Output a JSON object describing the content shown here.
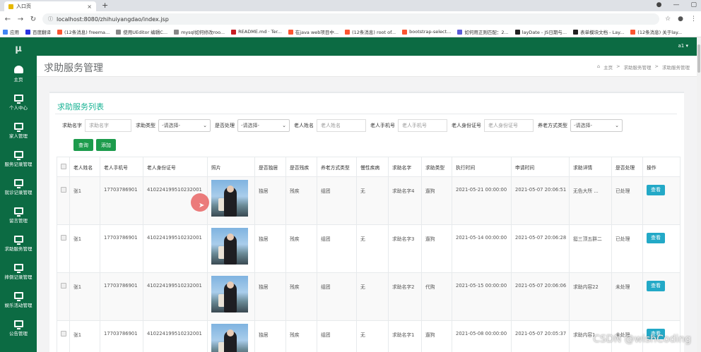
{
  "browser": {
    "tab_title": "入口页",
    "url": "localhost:8080/zhihuiyangdao/index.jsp",
    "bookmarks": [
      {
        "label": "应用",
        "color": "#4285f4"
      },
      {
        "label": "百度翻译",
        "color": "#2932e1"
      },
      {
        "label": "(12条消息) freema...",
        "color": "#fc5531"
      },
      {
        "label": "使用UEditor 编辑C...",
        "color": "#888888"
      },
      {
        "label": "mysql如何修改roo...",
        "color": "#888888"
      },
      {
        "label": "README.md · Ter...",
        "color": "#c71d23"
      },
      {
        "label": "在java web项目中...",
        "color": "#fc5531"
      },
      {
        "label": "(12条消息) root of...",
        "color": "#fc5531"
      },
      {
        "label": "bootstrap-select...",
        "color": "#fc5531"
      },
      {
        "label": "如何用正则匹配：2...",
        "color": "#5b5bd6"
      },
      {
        "label": "layDate - JS日期与...",
        "color": "#222222"
      },
      {
        "label": "表单模块文档 - Lay...",
        "color": "#222222"
      },
      {
        "label": "(12条消息) 关于lay...",
        "color": "#fc5531"
      }
    ]
  },
  "sidebar": {
    "logo": "μ",
    "items": [
      {
        "label": "主页",
        "icon": "dashboard-icon"
      },
      {
        "label": "个人中心",
        "icon": "monitor-icon"
      },
      {
        "label": "家人管理",
        "icon": "monitor-icon"
      },
      {
        "label": "服务记录管理",
        "icon": "monitor-icon"
      },
      {
        "label": "就诊记录管理",
        "icon": "monitor-icon"
      },
      {
        "label": "留言管理",
        "icon": "monitor-icon"
      },
      {
        "label": "求助服务管理",
        "icon": "monitor-icon"
      },
      {
        "label": "摔倒记录管理",
        "icon": "monitor-icon"
      },
      {
        "label": "娱乐活动管理",
        "icon": "monitor-icon"
      },
      {
        "label": "公告管理",
        "icon": "monitor-icon"
      }
    ]
  },
  "header": {
    "user": "a1 ▾",
    "page_title": "求助服务管理",
    "breadcrumb": [
      "主页",
      ">",
      "求助服务管理",
      ">",
      "求助服务管理"
    ]
  },
  "card": {
    "title": "求助服务列表",
    "filters": {
      "name_label": "求助名字",
      "name_placeholder": "求助名字",
      "type_label": "求助类型",
      "type_value": "-请选择-",
      "processed_label": "是否处理",
      "processed_value": "-请选择-",
      "elder_name_label": "老人姓名",
      "elder_name_placeholder": "老人姓名",
      "elder_phone_label": "老人手机号",
      "elder_phone_placeholder": "老人手机号",
      "elder_id_label": "老人身份证号",
      "elder_id_placeholder": "老人身份证号",
      "care_label": "养老方式类型",
      "care_value": "-请选择-"
    },
    "query_button": "查询",
    "add_button": "添加",
    "columns": [
      "老人姓名",
      "老人手机号",
      "老人身份证号",
      "照片",
      "是否独居",
      "是否残疾",
      "养老方式类型",
      "慢性疾病",
      "求助名字",
      "求助类型",
      "执行时间",
      "申请时间",
      "求助详情",
      "是否处理",
      "操作"
    ],
    "rows": [
      {
        "name": "张1",
        "phone": "17703786901",
        "id_no": "410224199510232001",
        "alone": "独居",
        "disabled": "残疾",
        "care": "组团",
        "disease": "无",
        "help_name": "求助名字4",
        "help_type": "遛狗",
        "exec_time": "2021-05-21 00:00:00",
        "apply_time": "2021-05-07 20:06:51",
        "detail": "无色大所 ...",
        "processed": "已处理",
        "action": "查看"
      },
      {
        "name": "张1",
        "phone": "17703786901",
        "id_no": "410224199510232001",
        "alone": "独居",
        "disabled": "残疾",
        "care": "组团",
        "disease": "无",
        "help_name": "求助名字3",
        "help_type": "遛狗",
        "exec_time": "2021-05-14 00:00:00",
        "apply_time": "2021-05-07 20:06:28",
        "detail": "挺三顶五群二",
        "processed": "已处理",
        "action": "查看"
      },
      {
        "name": "张1",
        "phone": "17703786901",
        "id_no": "410224199510232001",
        "alone": "独居",
        "disabled": "残疾",
        "care": "组团",
        "disease": "无",
        "help_name": "求助名字2",
        "help_type": "代购",
        "exec_time": "2021-05-15 00:00:00",
        "apply_time": "2021-05-07 20:06:06",
        "detail": "求助内容22",
        "processed": "未处理",
        "action": "查看"
      },
      {
        "name": "张1",
        "phone": "17703786901",
        "id_no": "410224199510232001",
        "alone": "独居",
        "disabled": "残疾",
        "care": "组团",
        "disease": "无",
        "help_name": "求助名字1",
        "help_type": "遛狗",
        "exec_time": "2021-05-08 00:00:00",
        "apply_time": "2021-05-07 20:05:37",
        "detail": "求助内容1",
        "processed": "未处理",
        "action": "查看"
      }
    ]
  },
  "watermark": "CSDN @wishCoding",
  "colors": {
    "sidebar": "#0c6b43",
    "accent": "#1ab394",
    "button": "#1c9b4c",
    "view_button": "#23a9c7"
  }
}
